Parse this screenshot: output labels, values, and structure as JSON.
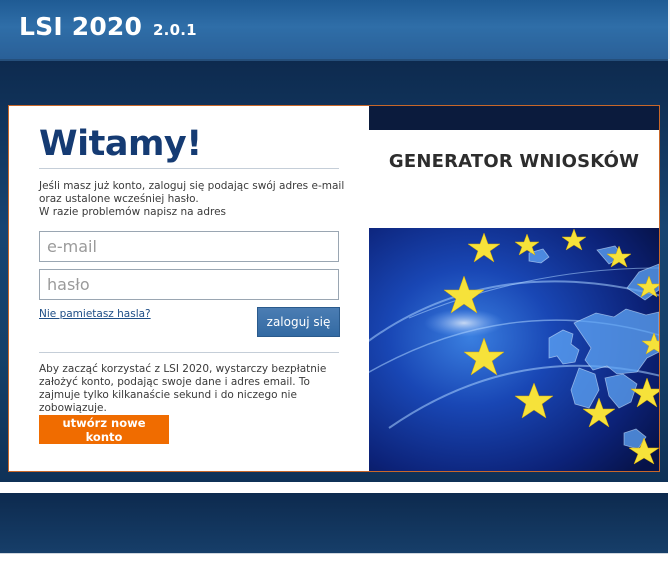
{
  "header": {
    "app_name": "LSI 2020",
    "version": "2.0.1"
  },
  "login": {
    "welcome": "Witamy!",
    "intro_line1": "Jeśli masz już konto, zaloguj się podając swój adres e-mail",
    "intro_line2": "oraz ustalone wcześniej hasło.",
    "intro_line3": "W razie problemów napisz na adres",
    "email_placeholder": "e-mail",
    "password_placeholder": "hasło",
    "forgot_link": "Nie pamietasz hasla?",
    "login_button": "zaloguj się",
    "register_info": "Aby zacząć korzystać z LSI 2020, wystarczy bezpłatnie założyć konto, podając swoje dane i adres email. To zajmuje tylko kilkanaście sekund i do niczego nie zobowiązuje.",
    "register_button": "utwórz nowe konto"
  },
  "banner": {
    "title": "GENERATOR WNIOSKÓW",
    "image": "eu-stars-europe-map"
  },
  "colors": {
    "header_blue": "#2f6ea8",
    "title_navy": "#153b73",
    "login_button": "#336aa3",
    "register_button": "#f06c00",
    "card_border": "#c8672a"
  }
}
